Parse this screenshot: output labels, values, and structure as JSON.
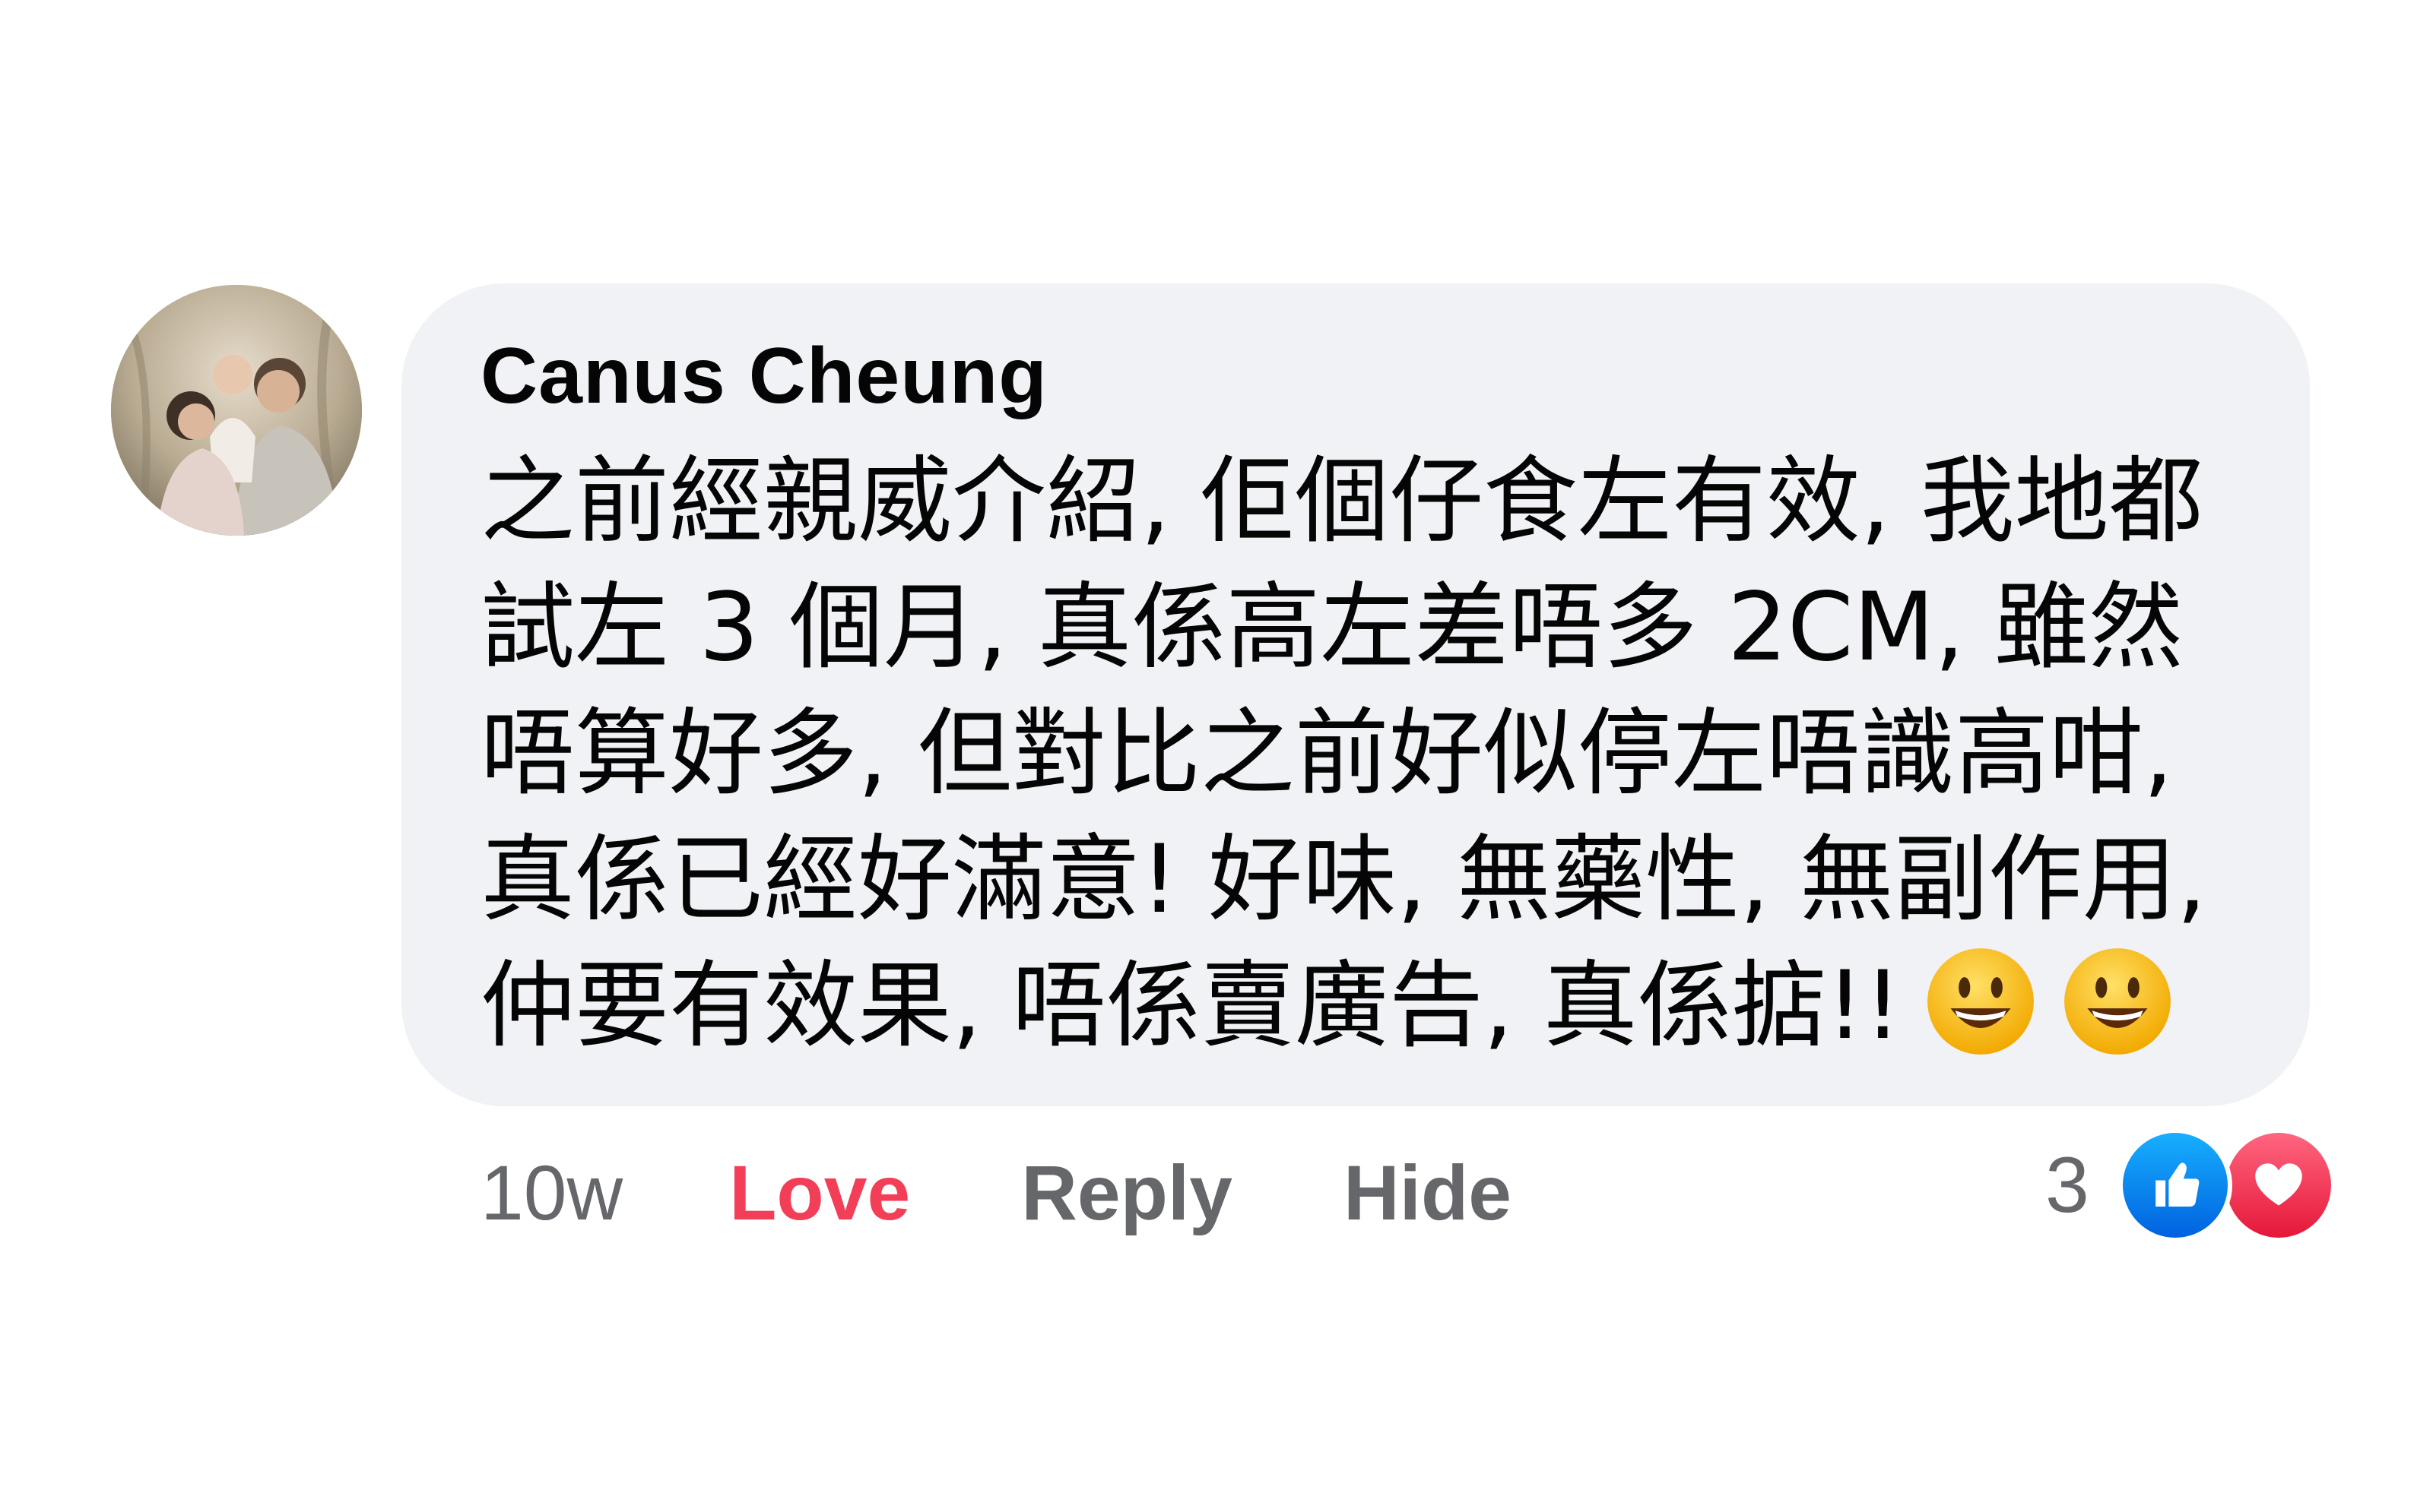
{
  "comment": {
    "author": "Canus Cheung",
    "text": "之前經親威介紹, 佢個仔食左有效, 我地都試左 3 個月, 真係高左差唔多 2CM, 雖然唔算好多, 但對比之前好似停左唔識高咁, 真係已經好滿意! 好味, 無藥性, 無副作用, 仲要有效果, 唔係賣廣告, 真係掂!!",
    "emojis": [
      "smiley-emoji",
      "smiley-emoji"
    ]
  },
  "actions": {
    "timestamp": "10w",
    "love_label": "Love",
    "reply_label": "Reply",
    "hide_label": "Hide"
  },
  "reactions": {
    "count": "3",
    "types": [
      "like-icon",
      "heart-icon"
    ]
  },
  "colors": {
    "bubble_bg": "#f0f2f5",
    "love_active": "#f33e58",
    "secondary_text": "#65676b",
    "like_blue": "#0866ff",
    "heart_red": "#f33e58"
  }
}
